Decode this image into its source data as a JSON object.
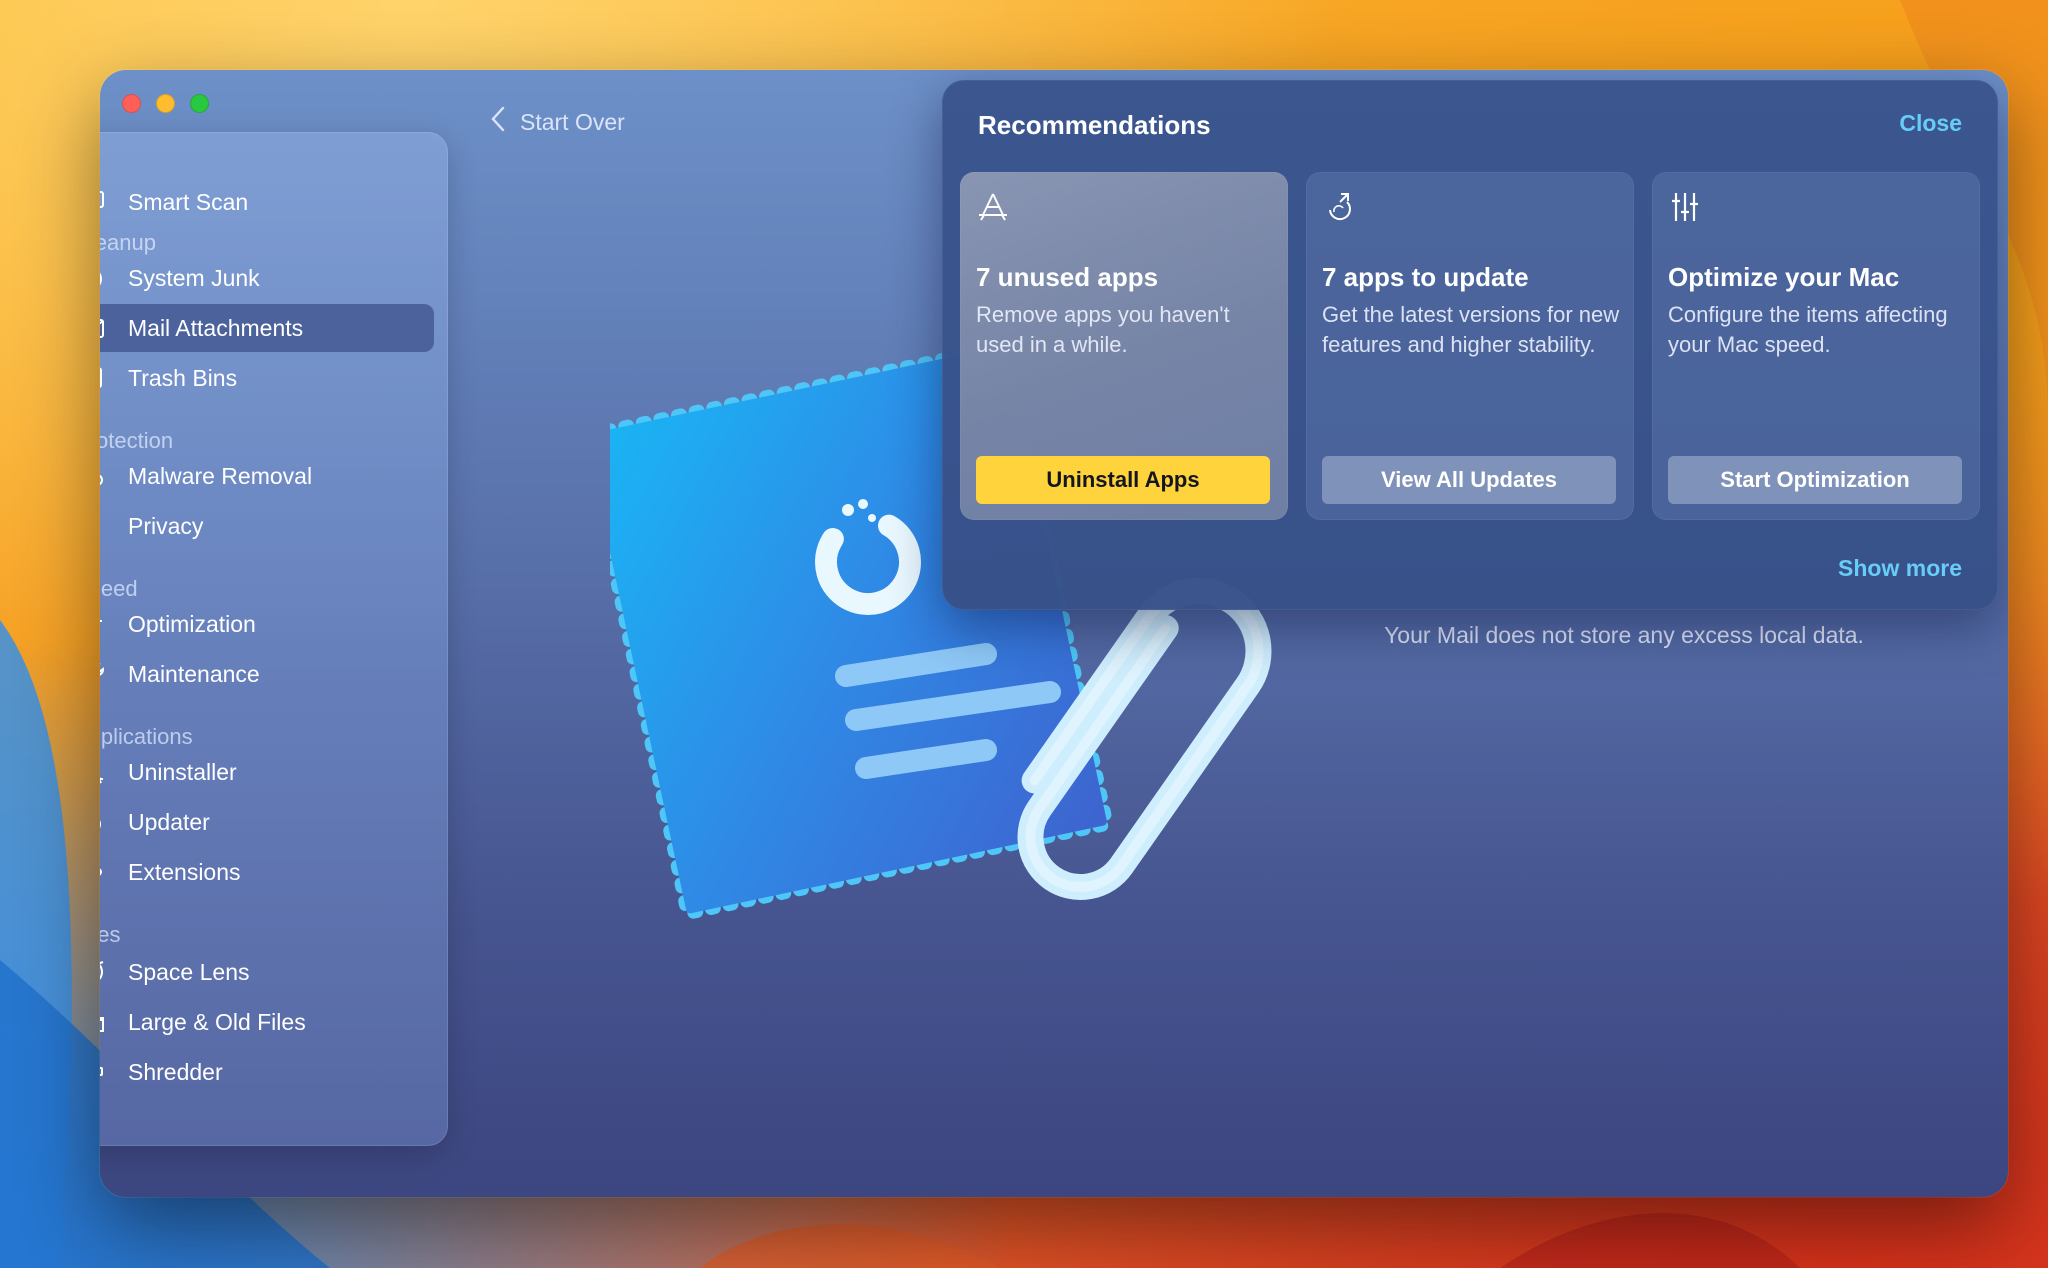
{
  "window": {
    "traffic_lights": [
      "close",
      "minimize",
      "zoom"
    ]
  },
  "sidebar": {
    "smart_scan": {
      "label": "Smart Scan",
      "icon": "monitor-icon"
    },
    "sections": [
      {
        "title": "Cleanup",
        "items": [
          {
            "label": "System Junk",
            "icon": "system-junk-icon"
          },
          {
            "label": "Mail Attachments",
            "icon": "envelope-icon",
            "active": true
          },
          {
            "label": "Trash Bins",
            "icon": "trash-bin-icon"
          }
        ]
      },
      {
        "title": "Protection",
        "items": [
          {
            "label": "Malware Removal",
            "icon": "biohazard-icon"
          },
          {
            "label": "Privacy",
            "icon": "hand-icon"
          }
        ]
      },
      {
        "title": "Speed",
        "items": [
          {
            "label": "Optimization",
            "icon": "sliders-icon"
          },
          {
            "label": "Maintenance",
            "icon": "wrench-icon"
          }
        ]
      },
      {
        "title": "Applications",
        "items": [
          {
            "label": "Uninstaller",
            "icon": "app-store-icon"
          },
          {
            "label": "Updater",
            "icon": "update-arrow-icon"
          },
          {
            "label": "Extensions",
            "icon": "puzzle-icon"
          }
        ]
      },
      {
        "title": "Files",
        "items": [
          {
            "label": "Space Lens",
            "icon": "planet-icon"
          },
          {
            "label": "Large & Old Files",
            "icon": "folder-icon"
          },
          {
            "label": "Shredder",
            "icon": "shredder-icon"
          }
        ]
      }
    ]
  },
  "toolbar": {
    "start_over": "Start Over"
  },
  "main": {
    "status_message": "Your Mail does not store any excess local data."
  },
  "recommendations": {
    "title": "Recommendations",
    "close": "Close",
    "show_more": "Show more",
    "cards": [
      {
        "icon": "app-store-icon",
        "title": "7 unused apps",
        "description": "Remove apps you haven't used in a while.",
        "button": "Uninstall Apps",
        "primary": true
      },
      {
        "icon": "update-arrow-icon",
        "title": "7 apps to update",
        "description": "Get the latest versions for new features and higher stability.",
        "button": "View All Updates",
        "primary": false
      },
      {
        "icon": "sliders-icon",
        "title": "Optimize your Mac",
        "description": "Configure the items affecting your Mac speed.",
        "button": "Start Optimization",
        "primary": false
      }
    ]
  },
  "colors": {
    "accent_link": "#67ccf6",
    "primary_button": "#fed33c",
    "window_top": "#6d90c8",
    "window_bottom": "#3c4680"
  }
}
